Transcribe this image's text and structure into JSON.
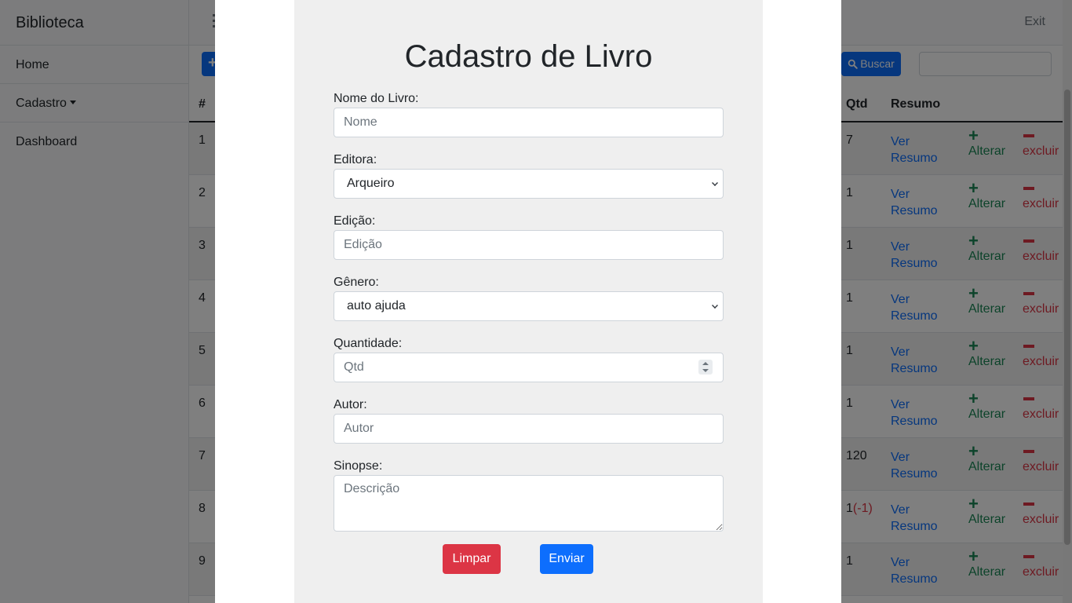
{
  "sidebar": {
    "brand": "Biblioteca",
    "items": [
      {
        "label": "Home"
      },
      {
        "label": "Cadastro"
      },
      {
        "label": "Dashboard"
      }
    ]
  },
  "topbar": {
    "exit_label": "Exit"
  },
  "toolbar": {
    "new_label": "+",
    "search_label": "Buscar",
    "search_value": ""
  },
  "table": {
    "headers": {
      "id": "#",
      "qtd": "Qtd",
      "resumo": "Resumo"
    },
    "rows": [
      {
        "id": "1",
        "qtd": "7",
        "qtd_delta": "",
        "resumo": "Ver Resumo",
        "alterar": "Alterar",
        "excluir": "excluir"
      },
      {
        "id": "2",
        "qtd": "1",
        "qtd_delta": "",
        "resumo": "Ver Resumo",
        "alterar": "Alterar",
        "excluir": "excluir"
      },
      {
        "id": "3",
        "qtd": "1",
        "qtd_delta": "",
        "resumo": "Ver Resumo",
        "alterar": "Alterar",
        "excluir": "excluir"
      },
      {
        "id": "4",
        "qtd": "1",
        "qtd_delta": "",
        "resumo": "Ver Resumo",
        "alterar": "Alterar",
        "excluir": "excluir"
      },
      {
        "id": "5",
        "qtd": "1",
        "qtd_delta": "",
        "resumo": "Ver Resumo",
        "alterar": "Alterar",
        "excluir": "excluir"
      },
      {
        "id": "6",
        "qtd": "1",
        "qtd_delta": "",
        "resumo": "Ver Resumo",
        "alterar": "Alterar",
        "excluir": "excluir"
      },
      {
        "id": "7",
        "qtd": "120",
        "qtd_delta": "",
        "resumo": "Ver Resumo",
        "alterar": "Alterar",
        "excluir": "excluir"
      },
      {
        "id": "8",
        "qtd": "1",
        "qtd_delta": "(-1)",
        "resumo": "Ver Resumo",
        "alterar": "Alterar",
        "excluir": "excluir"
      },
      {
        "id": "9",
        "qtd": "1",
        "qtd_delta": "",
        "resumo": "Ver Resumo",
        "alterar": "Alterar",
        "excluir": "excluir"
      }
    ]
  },
  "form": {
    "title": "Cadastro de Livro",
    "nome": {
      "label": "Nome do Livro:",
      "placeholder": "Nome",
      "value": ""
    },
    "editora": {
      "label": "Editora:",
      "selected": "Arqueiro"
    },
    "edicao": {
      "label": "Edição:",
      "placeholder": "Edição",
      "value": ""
    },
    "genero": {
      "label": "Gênero:",
      "selected": "auto ajuda"
    },
    "quantidade": {
      "label": "Quantidade:",
      "placeholder": "Qtd",
      "value": ""
    },
    "autor": {
      "label": "Autor:",
      "placeholder": "Autor",
      "value": ""
    },
    "sinopse": {
      "label": "Sinopse:",
      "placeholder": "Descrição",
      "value": ""
    },
    "buttons": {
      "clear": "Limpar",
      "submit": "Enviar"
    }
  },
  "colors": {
    "primary": "#0d6efd",
    "danger": "#dc3545",
    "success": "#198754",
    "card_bg": "#efefef",
    "backdrop": "rgba(0,0,0,0.5)"
  },
  "icons": {
    "toolbar_search": "search-icon",
    "alterar": "plus-icon",
    "excluir": "minus-icon",
    "select_arrow": "chevron-down-icon",
    "spinner": "spinner-arrows-icon"
  }
}
